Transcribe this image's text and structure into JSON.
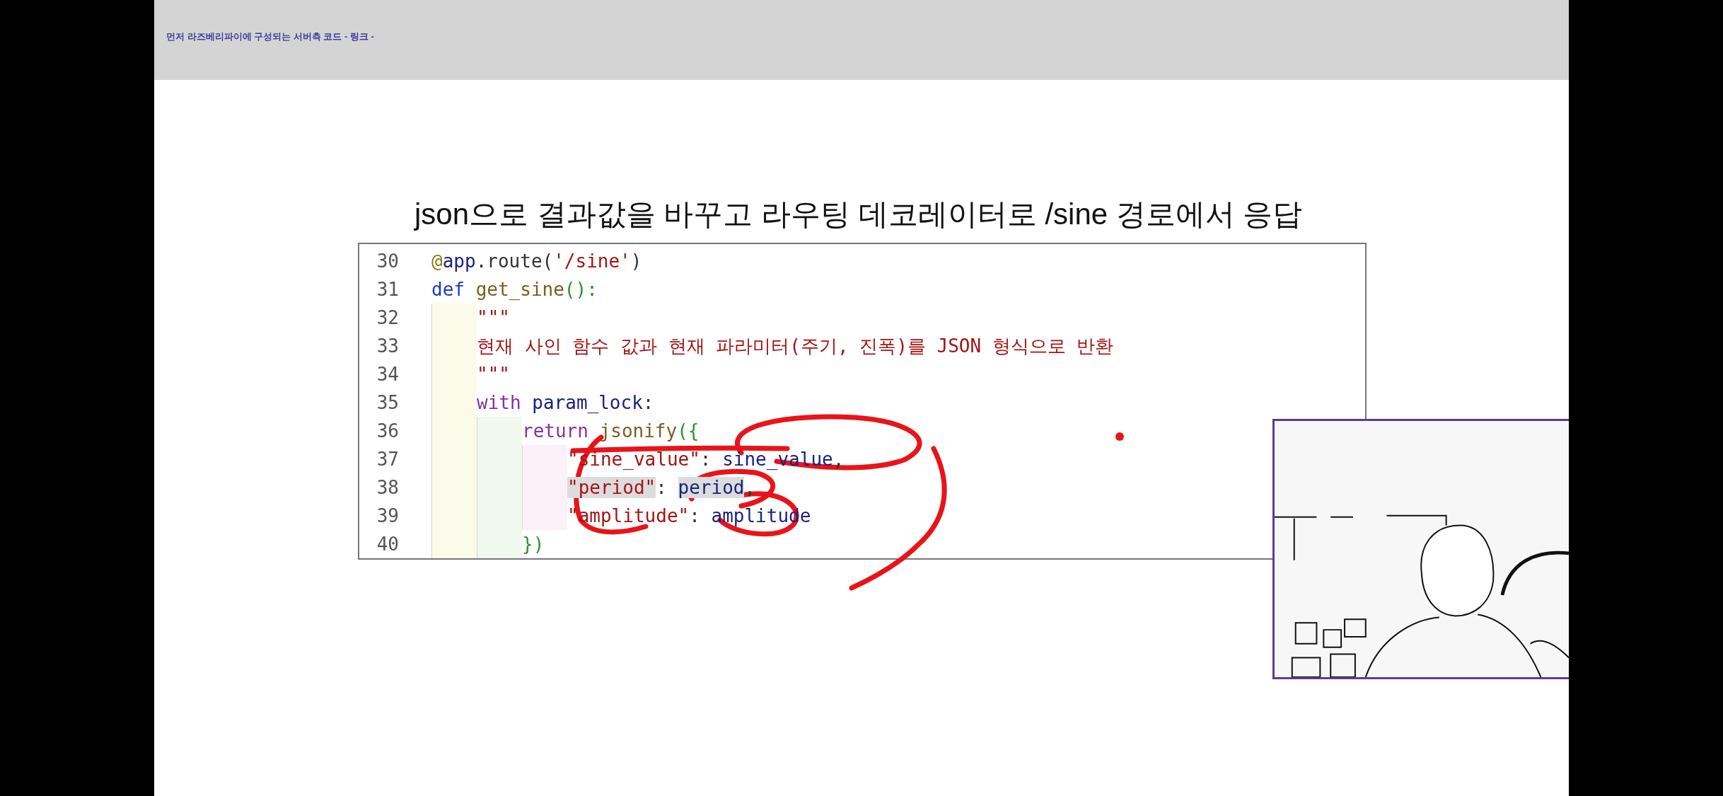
{
  "header": {
    "link_text": "먼저 라즈베리파이에 구성되는 서버측 코드 - 링크 -"
  },
  "slide": {
    "title": "json으로 결과값을 바꾸고 라우팅 데코레이터로 /sine 경로에서 응답",
    "code": {
      "lines": [
        {
          "number": "30",
          "tokens": [
            {
              "text": "@",
              "kind": "deco",
              "highlighted": false
            },
            {
              "text": "app",
              "kind": "var",
              "highlighted": false
            },
            {
              "text": ".route(",
              "kind": "plain",
              "highlighted": false
            },
            {
              "text": "'/sine'",
              "kind": "str",
              "highlighted": false
            },
            {
              "text": ")",
              "kind": "plain",
              "highlighted": false
            }
          ]
        },
        {
          "number": "31",
          "tokens": [
            {
              "text": "def ",
              "kind": "def",
              "highlighted": false
            },
            {
              "text": "get_sine",
              "kind": "fn",
              "highlighted": false
            },
            {
              "text": "():",
              "kind": "bracket",
              "highlighted": false
            }
          ],
          "children": [
            {
              "number": "32",
              "tokens": [
                {
                  "text": "\"\"\"",
                  "kind": "str",
                  "highlighted": false
                }
              ]
            },
            {
              "number": "33",
              "tokens": [
                {
                  "text": "현재 사인 함수 값과 현재 파라미터(주기, 진폭)를 JSON 형식으로 반환",
                  "kind": "str",
                  "highlighted": false
                }
              ]
            },
            {
              "number": "34",
              "tokens": [
                {
                  "text": "\"\"\"",
                  "kind": "str",
                  "highlighted": false
                }
              ]
            },
            {
              "number": "35",
              "tokens": [
                {
                  "text": "with ",
                  "kind": "kw",
                  "highlighted": false
                },
                {
                  "text": "param_lock",
                  "kind": "var",
                  "highlighted": false
                },
                {
                  "text": ":",
                  "kind": "plain",
                  "highlighted": false
                }
              ],
              "children": [
                {
                  "number": "36",
                  "tokens": [
                    {
                      "text": "return ",
                      "kind": "kw",
                      "highlighted": false
                    },
                    {
                      "text": "jsonify",
                      "kind": "fn",
                      "highlighted": false
                    },
                    {
                      "text": "({",
                      "kind": "bracket",
                      "highlighted": false
                    }
                  ],
                  "children": [
                    {
                      "number": "37",
                      "tokens": [
                        {
                          "text": "\"sine_value\"",
                          "kind": "str",
                          "highlighted": false
                        },
                        {
                          "text": ": ",
                          "kind": "plain",
                          "highlighted": false
                        },
                        {
                          "text": "sine_value",
                          "kind": "var",
                          "highlighted": false
                        },
                        {
                          "text": ",",
                          "kind": "plain",
                          "highlighted": false
                        }
                      ]
                    },
                    {
                      "number": "38",
                      "tokens": [
                        {
                          "text": "\"period\"",
                          "kind": "str",
                          "highlighted": true
                        },
                        {
                          "text": ": ",
                          "kind": "plain",
                          "highlighted": false
                        },
                        {
                          "text": "period",
                          "kind": "var",
                          "highlighted": true
                        },
                        {
                          "text": ",",
                          "kind": "plain",
                          "highlighted": false
                        }
                      ]
                    },
                    {
                      "number": "39",
                      "tokens": [
                        {
                          "text": "\"amplitude\"",
                          "kind": "str",
                          "highlighted": false
                        },
                        {
                          "text": ": ",
                          "kind": "plain",
                          "highlighted": false
                        },
                        {
                          "text": "amplitude",
                          "kind": "var",
                          "highlighted": false
                        }
                      ]
                    }
                  ]
                },
                {
                  "number": "40",
                  "tokens": [
                    {
                      "text": "})",
                      "kind": "bracket",
                      "highlighted": false
                    }
                  ]
                }
              ]
            }
          ]
        }
      ]
    }
  }
}
